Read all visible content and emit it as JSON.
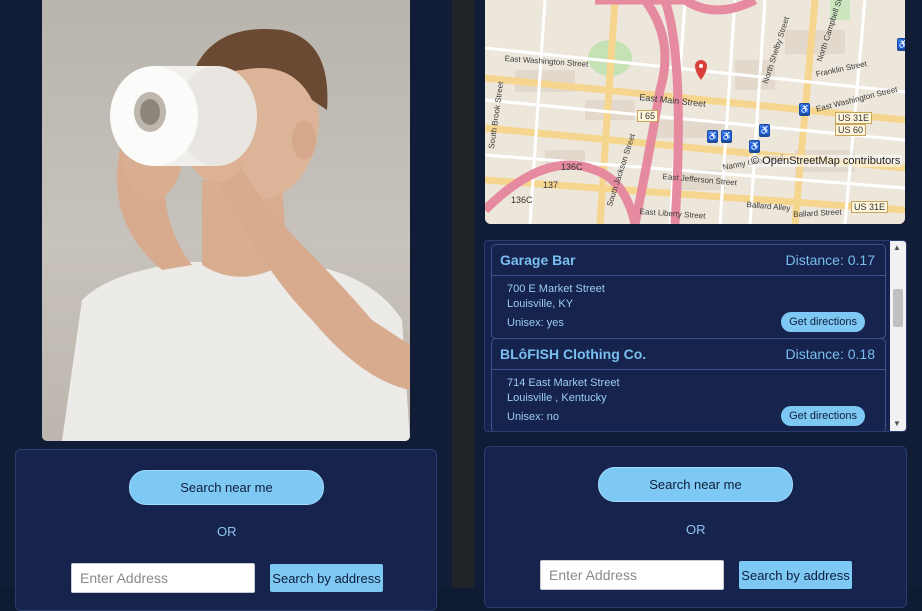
{
  "left": {
    "search_near_label": "Search near me",
    "or_label": "OR",
    "address_placeholder": "Enter Address",
    "search_address_label": "Search by address"
  },
  "map": {
    "attribution": "© OpenStreetMap contributors",
    "streets": [
      "East Washington Street",
      "East Main Street",
      "East Jefferson Street",
      "East Liberty Street",
      "South Jackson Street",
      "South Brook Street",
      "Ballard Alley",
      "Ballard Street",
      "Nanny Goat Strut",
      "North Shelby Street",
      "North Campbell Street",
      "Franklin Street",
      "East Washington Street"
    ],
    "shields": [
      "I 65",
      "136C",
      "137",
      "136C",
      "US 31E",
      "US 60",
      "US 31E"
    ]
  },
  "results": [
    {
      "name": "Garage Bar",
      "distance": "Distance: 0.17",
      "street": "700 E Market Street",
      "city": "Louisville, KY",
      "unisex": "Unisex: yes",
      "directions_label": "Get directions"
    },
    {
      "name": "BLôFISH Clothing Co.",
      "distance": "Distance: 0.18",
      "street": "714 East Market Street",
      "city": "Louisville , Kentucky",
      "unisex": "Unisex: no",
      "directions_label": "Get directions"
    }
  ],
  "right": {
    "search_near_label": "Search near me",
    "or_label": "OR",
    "address_placeholder": "Enter Address",
    "search_address_label": "Search by address"
  },
  "colors": {
    "background": "#111c36",
    "panel": "#15234d",
    "accent": "#7ec9f3",
    "link_text": "#79bff0"
  }
}
